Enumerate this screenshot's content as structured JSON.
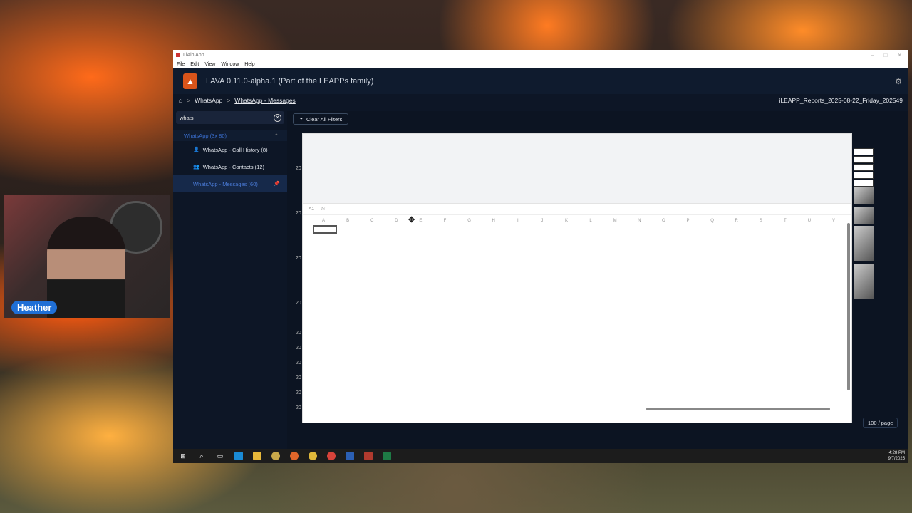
{
  "webcam": {
    "name": "Heather"
  },
  "window": {
    "title": "LiAlh App"
  },
  "menubar": [
    "File",
    "Edit",
    "View",
    "Window",
    "Help"
  ],
  "app": {
    "title": "LAVA 0.11.0-alpha.1 (Part of the LEAPPs family)"
  },
  "breadcrumb": {
    "level1": "WhatsApp",
    "level2": "WhatsApp - Messages",
    "report": "iLEAPP_Reports_2025-08-22_Friday_202549"
  },
  "sidebar": {
    "search_value": "whats",
    "group": "WhatsApp (3x 80)",
    "items": [
      {
        "label": "WhatsApp - Call History (8)"
      },
      {
        "label": "WhatsApp - Contacts (12)"
      },
      {
        "label": "WhatsApp - Messages (60)"
      }
    ]
  },
  "main": {
    "clear_filters": "Clear All Filters",
    "row_prefix": "20",
    "pager": "100 / page"
  },
  "sheet": {
    "cell_ref": "A1",
    "fx": "fx",
    "columns": [
      "A",
      "B",
      "C",
      "D",
      "E",
      "F",
      "G",
      "H",
      "I",
      "J",
      "K",
      "L",
      "M",
      "N",
      "O",
      "P",
      "Q",
      "R",
      "S",
      "T",
      "U",
      "V"
    ]
  },
  "taskbar": {
    "time": "4:28 PM",
    "date": "9/7/2025"
  }
}
